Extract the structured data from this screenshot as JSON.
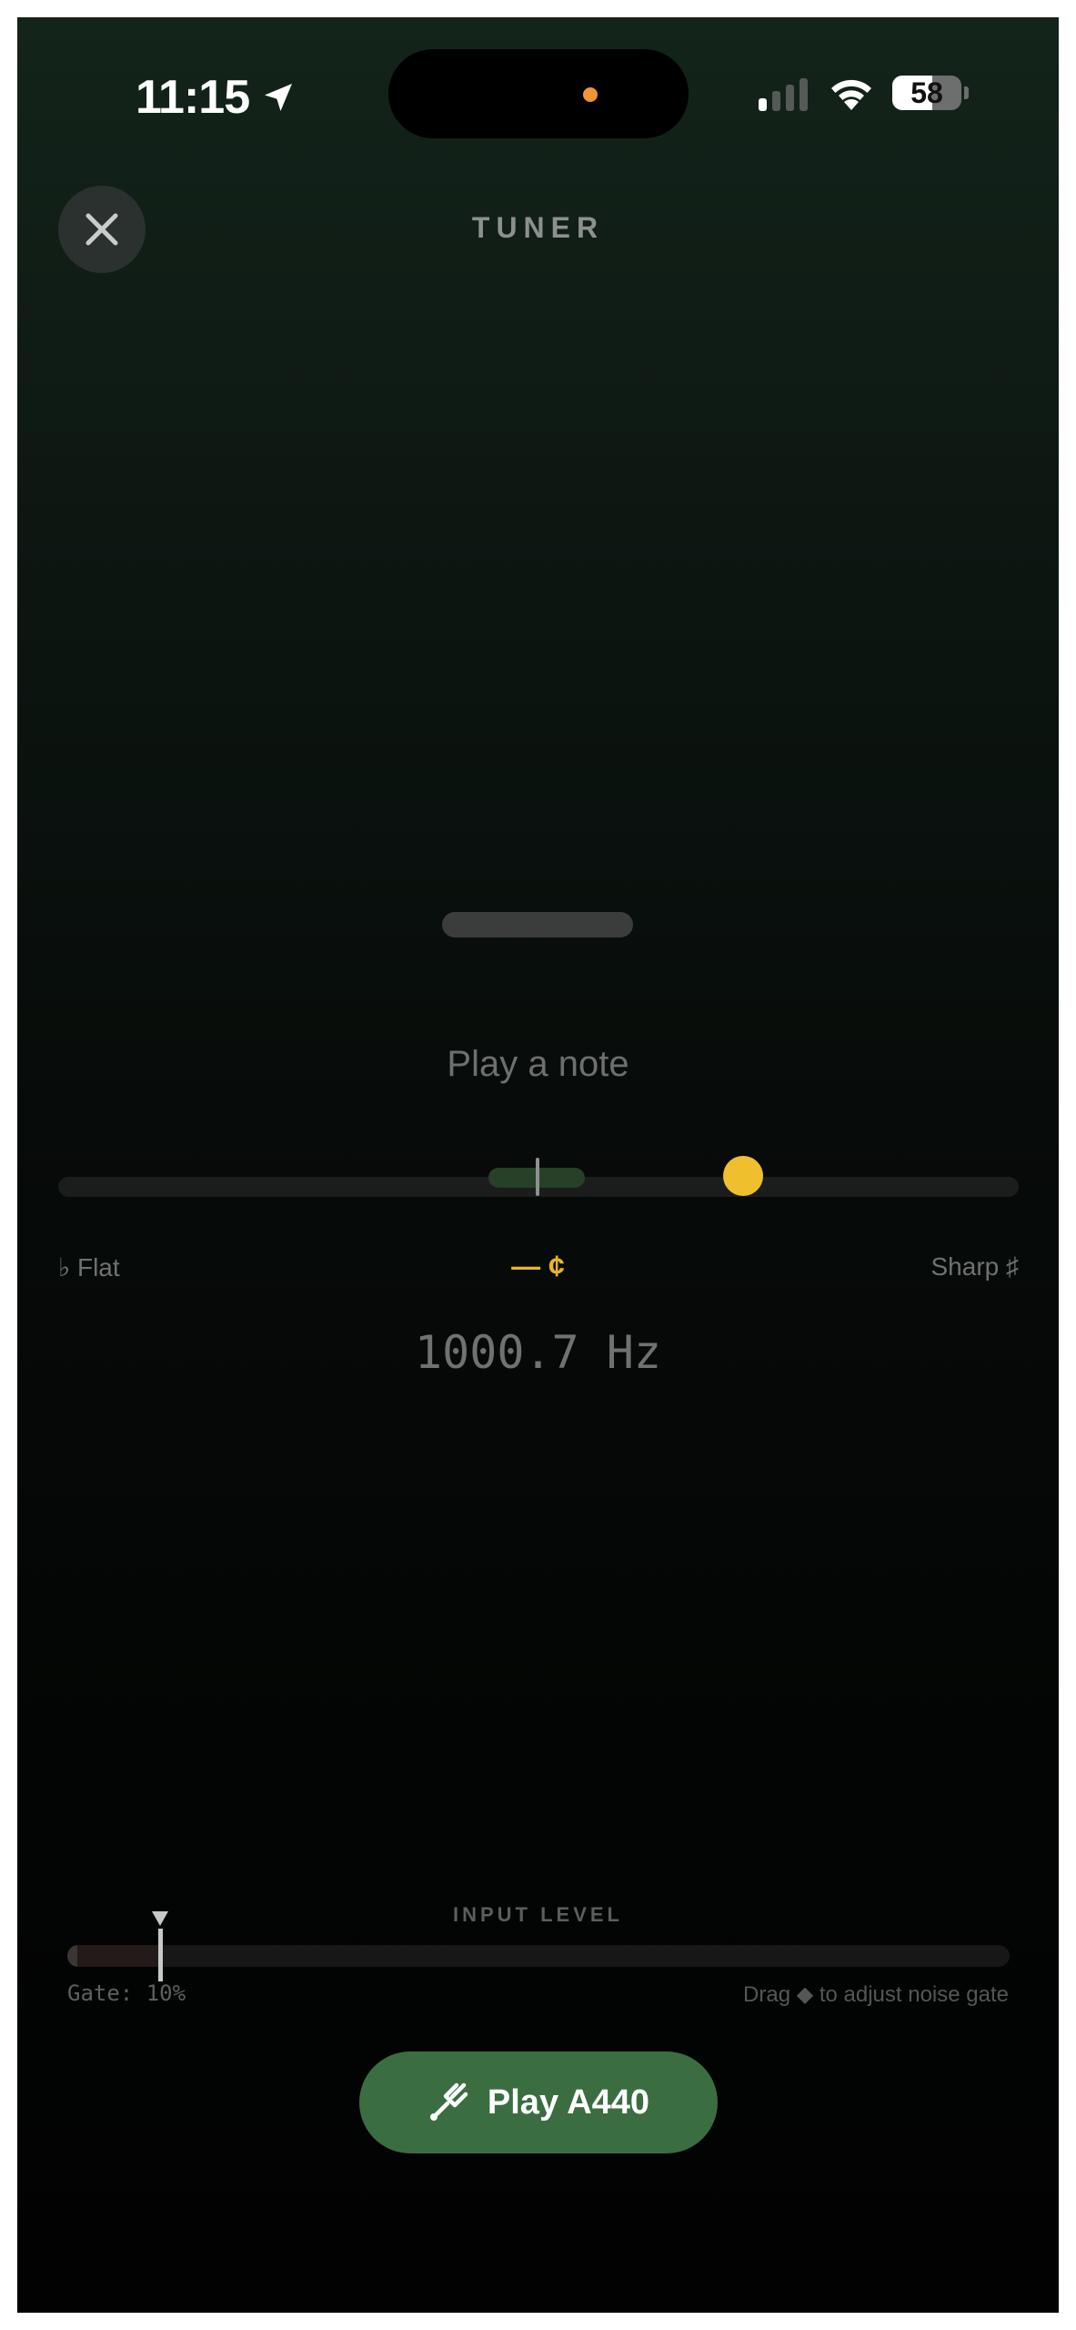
{
  "status_bar": {
    "time": "11:15",
    "location_icon": "location-arrow-icon",
    "signal_bars_active": 1,
    "signal_bars_total": 4,
    "wifi_icon": "wifi-icon",
    "battery_percent": "58",
    "battery_level": 0.58,
    "island_indicator_color": "#f0943a"
  },
  "header": {
    "close_icon": "close-icon",
    "title": "TUNER"
  },
  "tuner": {
    "prompt": "Play a note",
    "flat_label": "♭ Flat",
    "sharp_label": "Sharp ♯",
    "cents_display": "— ¢",
    "frequency": "1000.7 Hz",
    "accent_color": "#f0bf2e",
    "in_tune_zone_color": "#274028"
  },
  "input_level": {
    "title": "INPUT LEVEL",
    "gate_label": "Gate: 10%",
    "gate_value": 0.1,
    "hint": "Drag ◆ to adjust noise gate"
  },
  "play_button": {
    "label": "Play A440",
    "icon": "tuning-fork-icon",
    "color": "#3a6e41"
  }
}
